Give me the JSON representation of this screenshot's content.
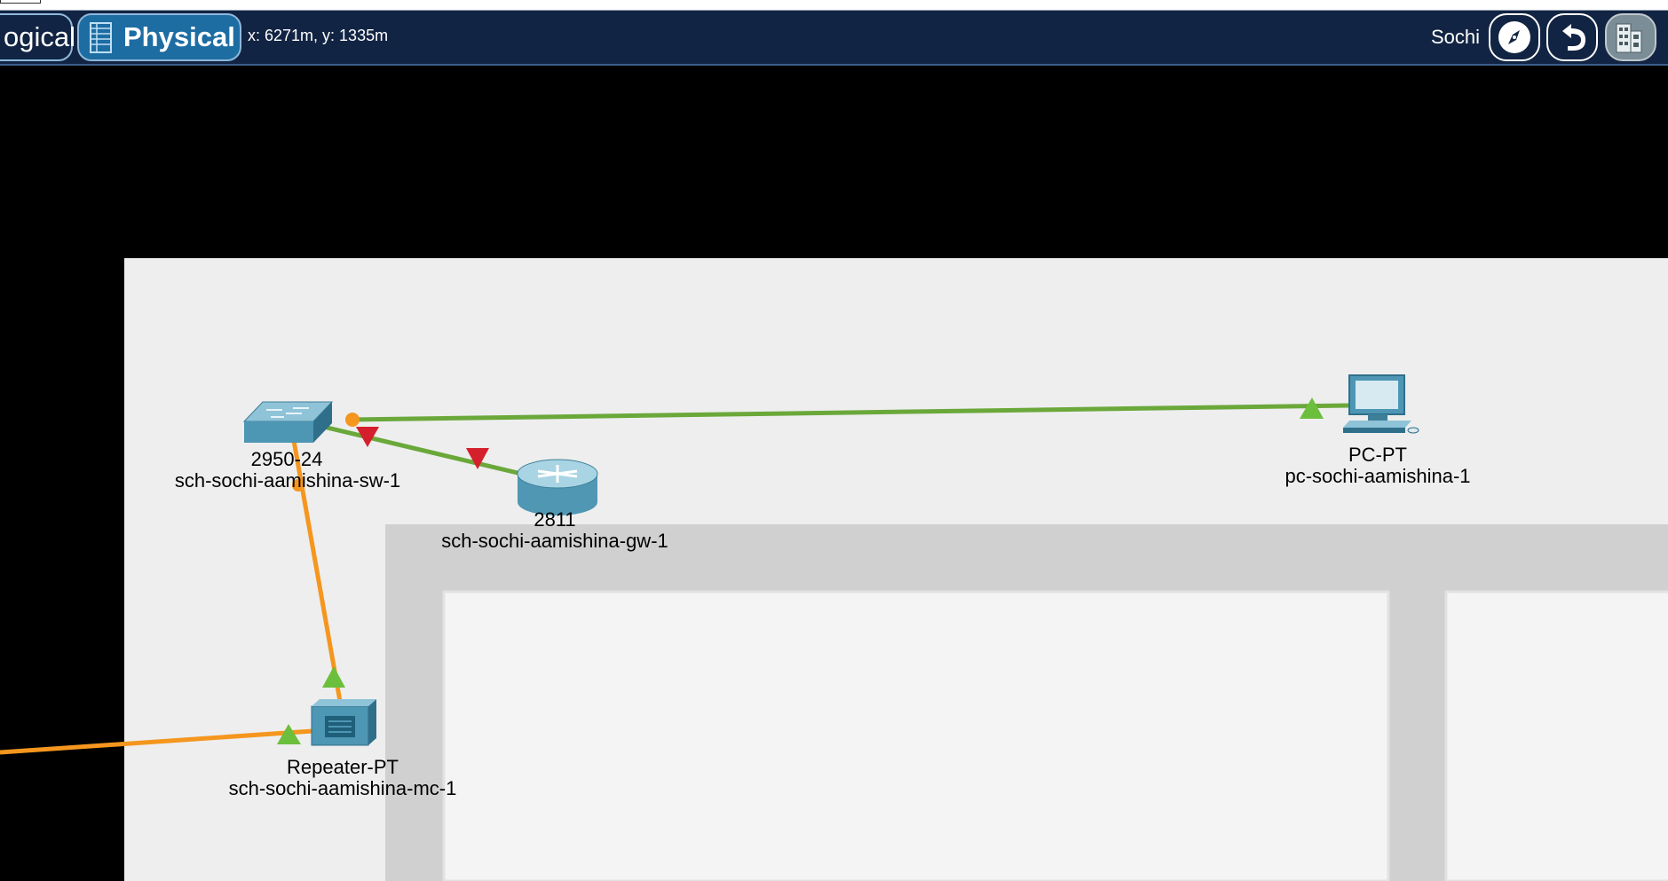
{
  "toolbar": {
    "logical_tab": "ogical",
    "physical_tab": "Physical",
    "coordinates": "x: 6271m, y: 1335m",
    "location": "Sochi",
    "icons": [
      "grid-icon",
      "compass-icon",
      "back-arrow-icon",
      "building-icon"
    ]
  },
  "devices": {
    "switch": {
      "model": "2950-24",
      "name": "sch-sochi-aamishina-sw-1",
      "icon": "switch-icon"
    },
    "router": {
      "model": "2811",
      "name": "sch-sochi-aamishina-gw-1",
      "icon": "router-icon"
    },
    "pc": {
      "model": "PC-PT",
      "name": "pc-sochi-aamishina-1",
      "icon": "pc-icon"
    },
    "repeater": {
      "model": "Repeater-PT",
      "name": "sch-sochi-aamishina-mc-1",
      "icon": "repeater-icon"
    }
  },
  "link_colors": {
    "copper": "#6aa83a",
    "fiber": "#f5961e",
    "link_up": "#6cbf3c",
    "link_down": "#d4202c"
  },
  "colors": {
    "toolbar_bg": "#122443",
    "active_tab": "#1d6da3",
    "floor": "#eeeeee",
    "wall": "#d0d0d0",
    "room": "#f4f4f4"
  }
}
